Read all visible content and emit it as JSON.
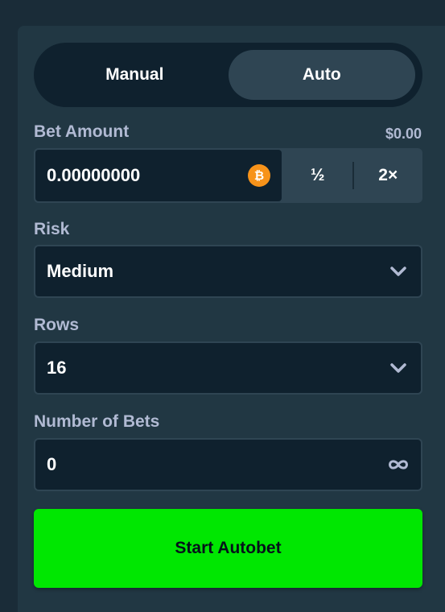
{
  "tabs": {
    "manual": "Manual",
    "auto": "Auto"
  },
  "bet": {
    "label": "Bet Amount",
    "usd_value": "$0.00",
    "amount": "0.00000000",
    "currency_icon": "bitcoin-icon",
    "currency_glyph": "₿",
    "half_label": "½",
    "double_label": "2×"
  },
  "risk": {
    "label": "Risk",
    "value": "Medium",
    "options": [
      "Medium"
    ]
  },
  "rows": {
    "label": "Rows",
    "value": "16",
    "options": [
      "16"
    ]
  },
  "bets": {
    "label": "Number of Bets",
    "value": "0",
    "icon": "infinity-icon"
  },
  "start_label": "Start Autobet",
  "colors": {
    "background": "#1a2c38",
    "panel": "#213743",
    "input_bg": "#0f212e",
    "border": "#2f4553",
    "accent_green": "#00e701",
    "bitcoin_orange": "#f7931a",
    "label_gray": "#b1bad3"
  }
}
